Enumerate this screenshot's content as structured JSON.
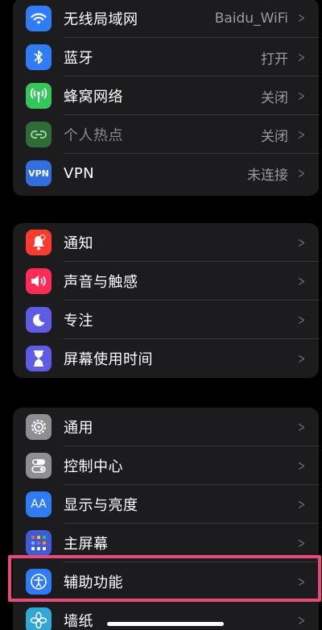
{
  "groups": [
    {
      "items": [
        {
          "label": "无线局域网",
          "value": "Baidu_WiFi",
          "icon": "wifi-icon",
          "color": "#2f7cf6"
        },
        {
          "label": "蓝牙",
          "value": "打开",
          "icon": "bluetooth-icon",
          "color": "#2f7cf6"
        },
        {
          "label": "蜂窝网络",
          "value": "关闭",
          "icon": "cellular-antenna-icon",
          "color": "#34c759"
        },
        {
          "label": "个人热点",
          "value": "关闭",
          "icon": "personal-hotspot-icon",
          "color": "#2e6b37",
          "disabled": true
        },
        {
          "label": "VPN",
          "value": "未连接",
          "icon": "vpn-icon",
          "icon_text": "VPN",
          "color": "#2f6fe0"
        }
      ]
    },
    {
      "items": [
        {
          "label": "通知",
          "icon": "notification-bell-icon",
          "color": "#ff3b30"
        },
        {
          "label": "声音与触感",
          "icon": "speaker-icon",
          "color": "#ff2d55"
        },
        {
          "label": "专注",
          "icon": "moon-icon",
          "color": "#5e5ce6"
        },
        {
          "label": "屏幕使用时间",
          "icon": "hourglass-icon",
          "color": "#5e5ce6"
        }
      ]
    },
    {
      "items": [
        {
          "label": "通用",
          "icon": "gear-icon",
          "color": "#8e8e93"
        },
        {
          "label": "控制中心",
          "icon": "toggle-switches-icon",
          "color": "#8e8e93"
        },
        {
          "label": "显示与亮度",
          "icon": "text-size-icon",
          "icon_text": "AA",
          "color": "#2f7cf6"
        },
        {
          "label": "主屏幕",
          "icon": "home-screen-grid-icon",
          "color": "#3f5bd8"
        },
        {
          "label": "辅助功能",
          "icon": "accessibility-icon",
          "color": "#2f7cf6"
        },
        {
          "label": "墙纸",
          "icon": "wallpaper-flower-icon",
          "color": "#35a7d6"
        }
      ]
    }
  ],
  "highlight_color": "#e64a7a"
}
